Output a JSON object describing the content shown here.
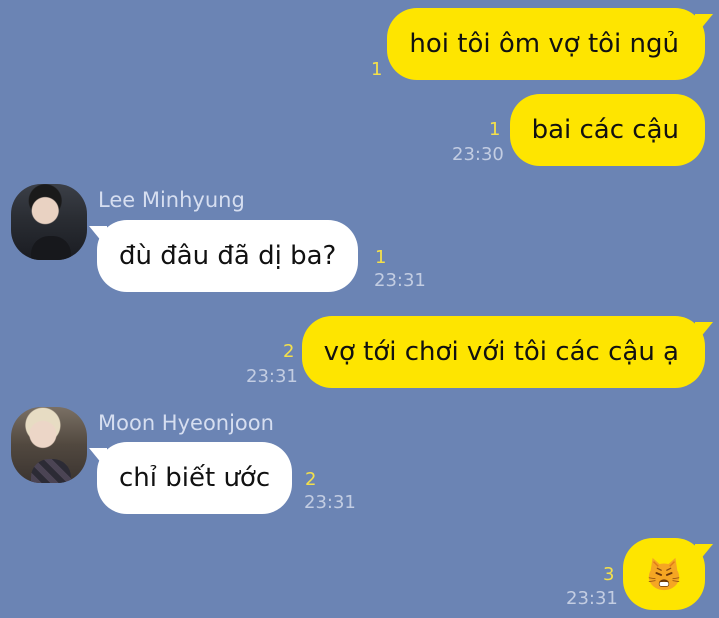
{
  "messages": [
    {
      "text": "hoi tôi ôm vợ tôi ngủ",
      "unread": "1"
    },
    {
      "text": "bai các cậu",
      "unread": "1",
      "time": "23:30"
    },
    {
      "sender": "Lee Minhyung",
      "text": "đù đâu đã dị ba?",
      "unread": "1",
      "time": "23:31"
    },
    {
      "text": "vợ tới chơi với tôi các cậu ạ",
      "unread": "2",
      "time": "23:31"
    },
    {
      "sender": "Moon Hyeonjoon",
      "text": "chỉ biết ước",
      "unread": "2",
      "time": "23:31"
    },
    {
      "emoji": "cat-face-icon",
      "unread": "3",
      "time": "23:31"
    }
  ],
  "colors": {
    "background": "#6b84b4",
    "outgoing_bubble": "#fee500",
    "incoming_bubble": "#ffffff",
    "unread_count": "#f4e04a",
    "timestamp": "#c3cde2",
    "sender_name": "#d6def0"
  }
}
